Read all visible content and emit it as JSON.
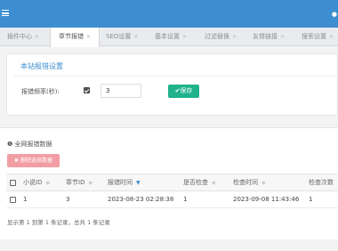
{
  "tabs": [
    {
      "label": "插件中心"
    },
    {
      "label": "章节报错"
    },
    {
      "label": "SEO设置"
    },
    {
      "label": "基本设置"
    },
    {
      "label": "过滤替换"
    },
    {
      "label": "友情链接"
    },
    {
      "label": "搜索设置"
    }
  ],
  "settings": {
    "title": "本站报错设置",
    "frequency_label": "报错频率(秒):",
    "frequency_value": "3",
    "save_label": "✔保存"
  },
  "data_section": {
    "title": "全网报错数据",
    "delete_label": "✖ 删除选择数据",
    "columns": [
      "小说ID",
      "章节ID",
      "报错时间",
      "是否检查",
      "检查时间",
      "检查次数"
    ],
    "rows": [
      [
        "1",
        "3",
        "2023-08-23 02:28:38",
        "1",
        "2023-09-08 11:43:46",
        "1"
      ]
    ],
    "footer": "显示第 1 到第 1 条记录，总共 1 条记录"
  }
}
